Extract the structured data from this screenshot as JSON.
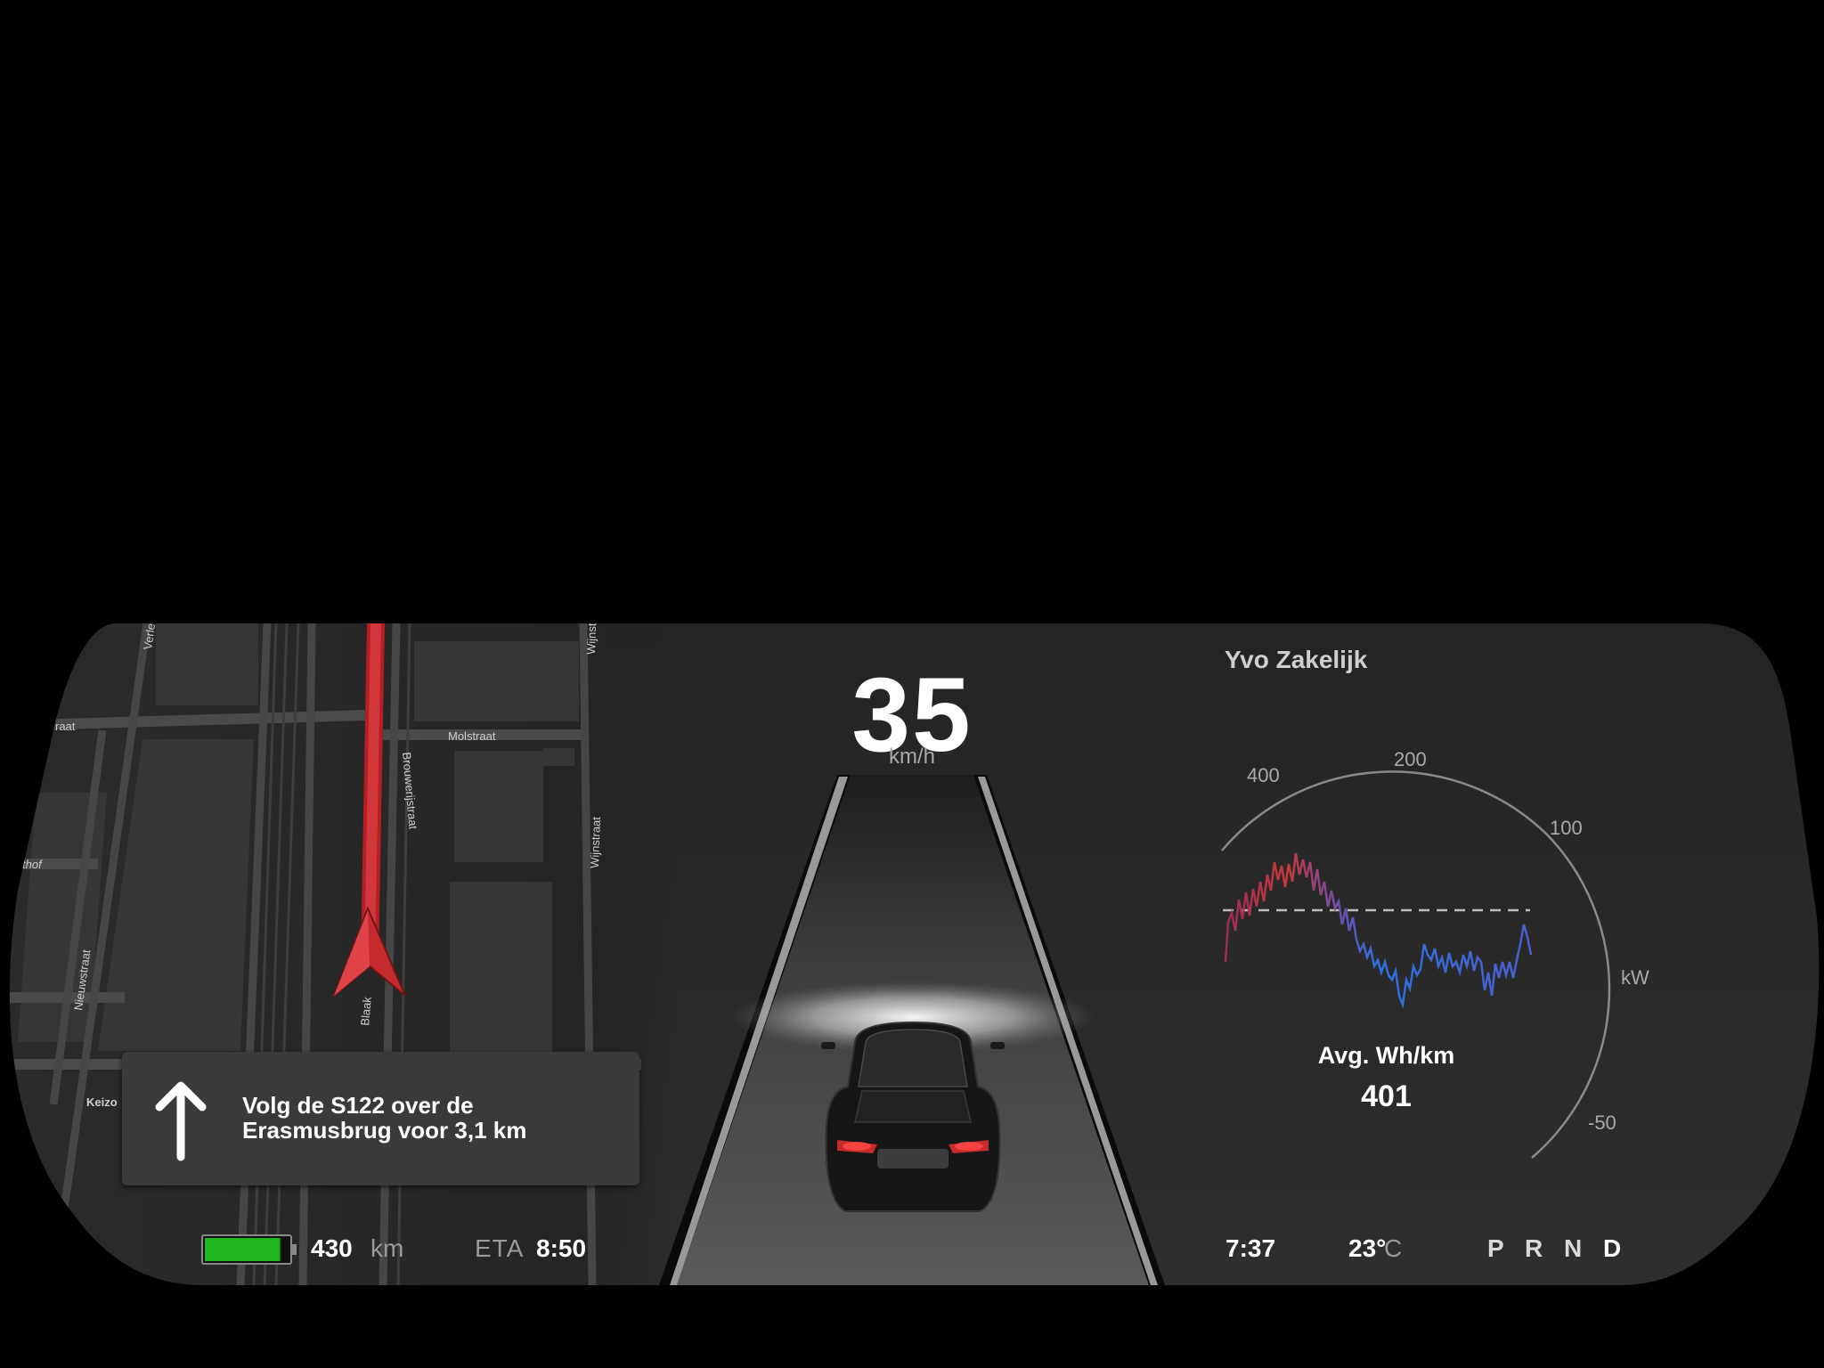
{
  "speed": {
    "value": "35",
    "unit": "km/h"
  },
  "navigation": {
    "instruction": "Volg de S122 over de\nErasmusbrug voor 3,1 km",
    "arrow_icon": "arrow-up-icon",
    "map_streets": [
      "Verle",
      "Molstraat",
      "Brouwerijstraat",
      "Wijnstraat",
      "Wijnstr",
      "raat",
      "thof",
      "Nieuwstraat",
      "Blaak",
      "Keizo"
    ]
  },
  "battery": {
    "level_fraction": 0.9,
    "range_value": "430",
    "range_unit": "km",
    "color": "#1fb51f"
  },
  "eta": {
    "label": "ETA",
    "value": "8:50"
  },
  "status": {
    "clock": "7:37",
    "temperature": "23°",
    "temperature_unit": "C"
  },
  "gears": {
    "items": [
      "P",
      "R",
      "N",
      "D"
    ],
    "selected": "D"
  },
  "energy": {
    "profile_name": "Yvo Zakelijk",
    "ticks": {
      "t400": "400",
      "t200": "200",
      "t100": "100",
      "tminus50": "-50"
    },
    "unit": "kW",
    "avg_label": "Avg. Wh/km",
    "avg_value": "401",
    "trace_colors": {
      "high": "#c8373a",
      "low": "#2f6fe0"
    }
  }
}
